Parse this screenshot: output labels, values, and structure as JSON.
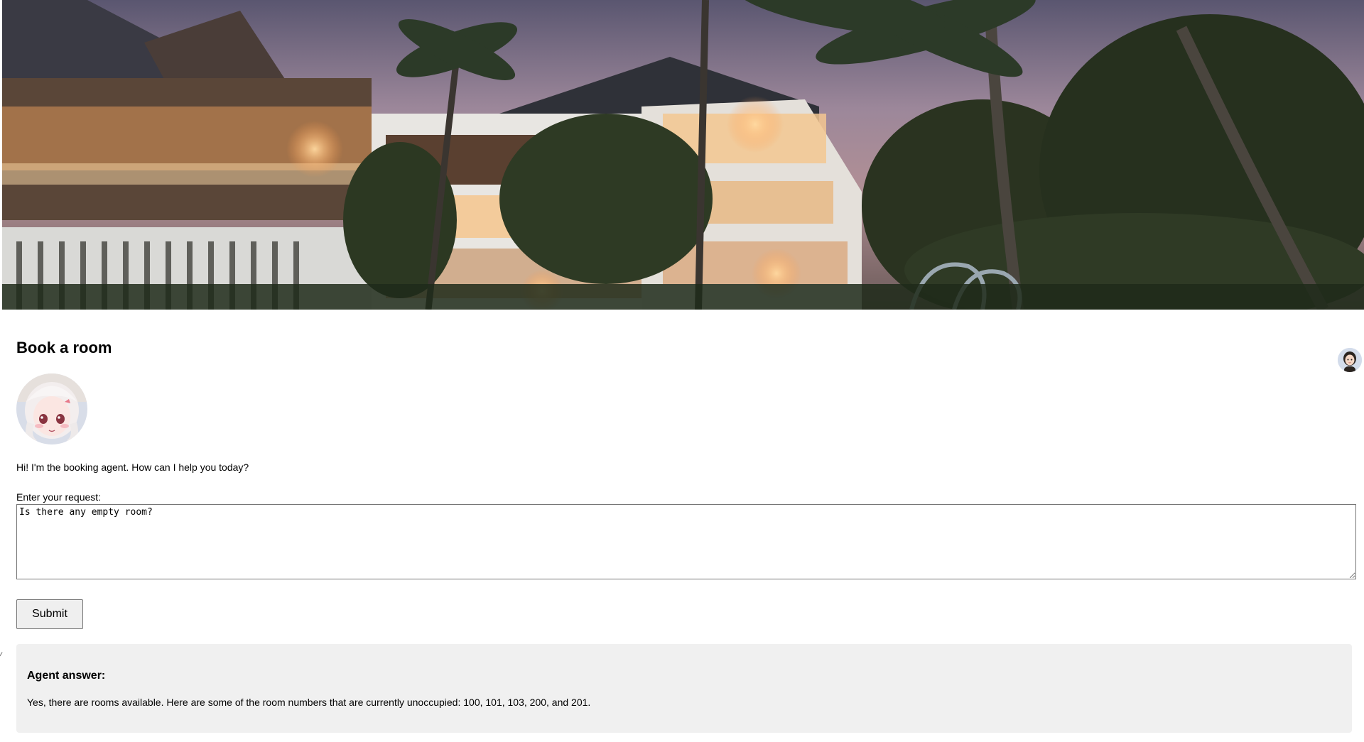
{
  "hero": {
    "image": "resort-at-dusk-photo"
  },
  "page": {
    "title": "Book a room",
    "agent_avatar": "anime-agent-avatar",
    "greeting": "Hi! I'm the booking agent. How can I help you today?"
  },
  "form": {
    "label": "Enter your request:",
    "request_value": "Is there any empty room?",
    "submit_label": "Submit"
  },
  "answer": {
    "heading": "Agent answer:",
    "text": "Yes, there are rooms available. Here are some of the room numbers that are currently unoccupied: 100, 101, 103, 200, and 201."
  },
  "corner": {
    "avatar": "assistant-avatar-icon"
  }
}
